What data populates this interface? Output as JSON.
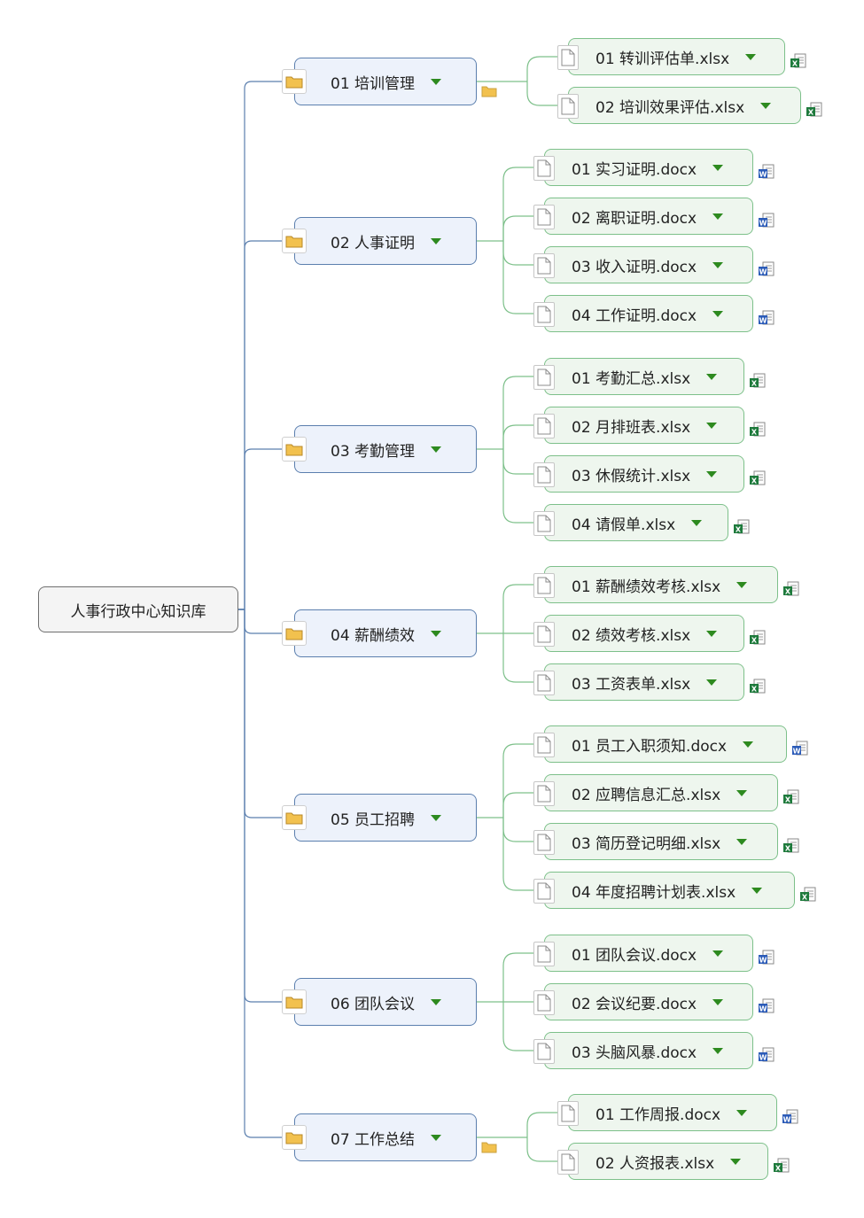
{
  "root": {
    "label": "人事行政中心知识库"
  },
  "colors": {
    "trunk": "#5b7fae",
    "leaf_link": "#7dc08a",
    "excel": "#1e7a3c",
    "word": "#2b5bb8",
    "folder": "#f2c14e",
    "arrow": "#2d8a1f"
  },
  "branches": [
    {
      "label": "01 培训管理",
      "collapsed_folder": true,
      "children": [
        {
          "label": "01 转训评估单.xlsx",
          "type": "excel"
        },
        {
          "label": "02 培训效果评估.xlsx",
          "type": "excel"
        }
      ]
    },
    {
      "label": "02 人事证明",
      "collapsed_folder": false,
      "children": [
        {
          "label": "01 实习证明.docx",
          "type": "word"
        },
        {
          "label": "02 离职证明.docx",
          "type": "word"
        },
        {
          "label": "03 收入证明.docx",
          "type": "word"
        },
        {
          "label": "04 工作证明.docx",
          "type": "word"
        }
      ]
    },
    {
      "label": "03 考勤管理",
      "collapsed_folder": false,
      "children": [
        {
          "label": "01 考勤汇总.xlsx",
          "type": "excel"
        },
        {
          "label": "02 月排班表.xlsx",
          "type": "excel"
        },
        {
          "label": "03 休假统计.xlsx",
          "type": "excel"
        },
        {
          "label": "04 请假单.xlsx",
          "type": "excel"
        }
      ]
    },
    {
      "label": "04 薪酬绩效",
      "collapsed_folder": false,
      "children": [
        {
          "label": "01 薪酬绩效考核.xlsx",
          "type": "excel"
        },
        {
          "label": "02 绩效考核.xlsx",
          "type": "excel"
        },
        {
          "label": "03 工资表单.xlsx",
          "type": "excel"
        }
      ]
    },
    {
      "label": "05 员工招聘",
      "collapsed_folder": false,
      "children": [
        {
          "label": "01 员工入职须知.docx",
          "type": "word"
        },
        {
          "label": "02 应聘信息汇总.xlsx",
          "type": "excel"
        },
        {
          "label": "03 简历登记明细.xlsx",
          "type": "excel"
        },
        {
          "label": "04 年度招聘计划表.xlsx",
          "type": "excel"
        }
      ]
    },
    {
      "label": "06 团队会议",
      "collapsed_folder": false,
      "children": [
        {
          "label": "01 团队会议.docx",
          "type": "word"
        },
        {
          "label": "02 会议纪要.docx",
          "type": "word"
        },
        {
          "label": "03 头脑风暴.docx",
          "type": "word"
        }
      ]
    },
    {
      "label": "07 工作总结",
      "collapsed_folder": true,
      "children": [
        {
          "label": "01 工作周报.docx",
          "type": "word"
        },
        {
          "label": "02 人资报表.xlsx",
          "type": "excel"
        }
      ]
    }
  ]
}
